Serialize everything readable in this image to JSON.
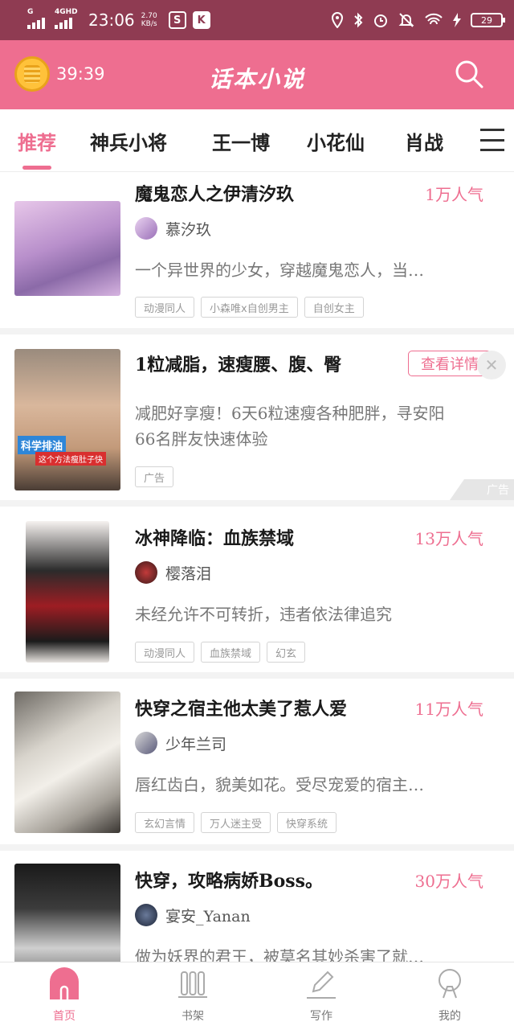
{
  "status_bar": {
    "network_label": "G",
    "network2_label": "4GHD",
    "time": "23:06",
    "speed_value": "2.70",
    "speed_unit": "KB/s",
    "app1": "S",
    "app2": "K",
    "battery": "29",
    "icons": [
      "location-icon",
      "bluetooth-icon",
      "alarm-icon",
      "mute-icon",
      "wifi-icon",
      "charging-icon"
    ]
  },
  "header": {
    "timer": "39:39",
    "title": "话本小说"
  },
  "tabs": [
    "推荐",
    "神兵小将",
    "王一博",
    "小花仙",
    "肖战"
  ],
  "books": [
    {
      "title": "魔鬼恋人之伊清汐玖",
      "popularity": "1万人气",
      "author": "慕汐玖",
      "desc": "一个异世界的少女，穿越魔鬼恋人，当…",
      "tags": [
        "动漫同人",
        "小森唯x自创男主",
        "自创女主"
      ]
    },
    {
      "title": "冰神降临：血族禁域",
      "popularity": "13万人气",
      "author": "樱落泪",
      "desc": "未经允许不可转折，违者依法律追究",
      "tags": [
        "动漫同人",
        "血族禁域",
        "幻玄"
      ]
    },
    {
      "title": "快穿之宿主他太美了惹人爱",
      "popularity": "11万人气",
      "author": "少年兰司",
      "desc": "唇红齿白，貌美如花。受尽宠爱的宿主…",
      "tags": [
        "玄幻言情",
        "万人迷主受",
        "快穿系统"
      ]
    },
    {
      "title": "快穿，攻略病娇Boss。",
      "popularity": "30万人气",
      "author": "宴安_Yanan",
      "desc": "做为妖界的君王，被莫名其妙杀害了就…",
      "tags": []
    }
  ],
  "ad": {
    "title": "1粒减脂，速瘦腰、腹、臀",
    "button": "查看详情",
    "close": "✕",
    "desc_line1": "减肥好享瘦！6天6粒速瘦各种肥胖，寻安阳",
    "desc_line2": "66名胖友快速体验",
    "tag": "广告",
    "mark": "广告",
    "image_text1": "科学排油",
    "image_text2": "这个方法瘦肚子快"
  },
  "bottom_nav": [
    {
      "label": "首页",
      "icon": "home-icon"
    },
    {
      "label": "书架",
      "icon": "bookshelf-icon"
    },
    {
      "label": "写作",
      "icon": "pen-icon"
    },
    {
      "label": "我的",
      "icon": "profile-icon"
    }
  ],
  "colors": {
    "accent": "#ee6e90",
    "status_bar": "#8f3b52"
  }
}
